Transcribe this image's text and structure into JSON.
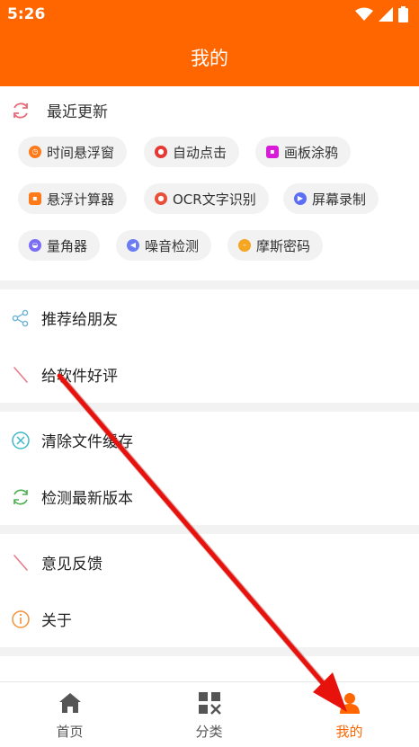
{
  "status_bar": {
    "time": "5:26"
  },
  "header": {
    "title": "我的"
  },
  "recent": {
    "title": "最近更新",
    "tools": [
      {
        "label": "时间悬浮窗",
        "color": "#ff7a1a",
        "icon": "clock-icon"
      },
      {
        "label": "自动点击",
        "color": "#e53935",
        "icon": "hand-icon"
      },
      {
        "label": "画板涂鸦",
        "color": "#d81bd8",
        "icon": "palette-icon"
      },
      {
        "label": "悬浮计算器",
        "color": "#ff7a1a",
        "icon": "calculator-icon"
      },
      {
        "label": "OCR文字识别",
        "color": "#e8503a",
        "icon": "ocr-icon"
      },
      {
        "label": "屏幕录制",
        "color": "#5b6ef5",
        "icon": "video-icon"
      },
      {
        "label": "量角器",
        "color": "#7b6ef5",
        "icon": "protractor-icon"
      },
      {
        "label": "噪音检测",
        "color": "#6b7cf5",
        "icon": "sound-icon"
      },
      {
        "label": "摩斯密码",
        "color": "#f5a623",
        "icon": "morse-icon"
      }
    ]
  },
  "menu_groups": [
    [
      {
        "label": "推荐给朋友",
        "icon": "share-icon",
        "color": "#6fb3d2"
      },
      {
        "label": "给软件好评",
        "icon": "pen-icon",
        "color": "#e87a8a"
      }
    ],
    [
      {
        "label": "清除文件缓存",
        "icon": "clear-icon",
        "color": "#3fb8c8"
      },
      {
        "label": "检测最新版本",
        "icon": "refresh-icon",
        "color": "#4caf50"
      }
    ],
    [
      {
        "label": "意见反馈",
        "icon": "pen-icon",
        "color": "#e87a8a"
      },
      {
        "label": "关于",
        "icon": "info-icon",
        "color": "#f5913a"
      }
    ]
  ],
  "tabs": [
    {
      "label": "首页",
      "icon": "home-icon"
    },
    {
      "label": "分类",
      "icon": "category-icon"
    },
    {
      "label": "我的",
      "icon": "person-icon",
      "active": true
    }
  ],
  "colors": {
    "brand": "#ff6600",
    "annotation_arrow": "#e8120c"
  }
}
